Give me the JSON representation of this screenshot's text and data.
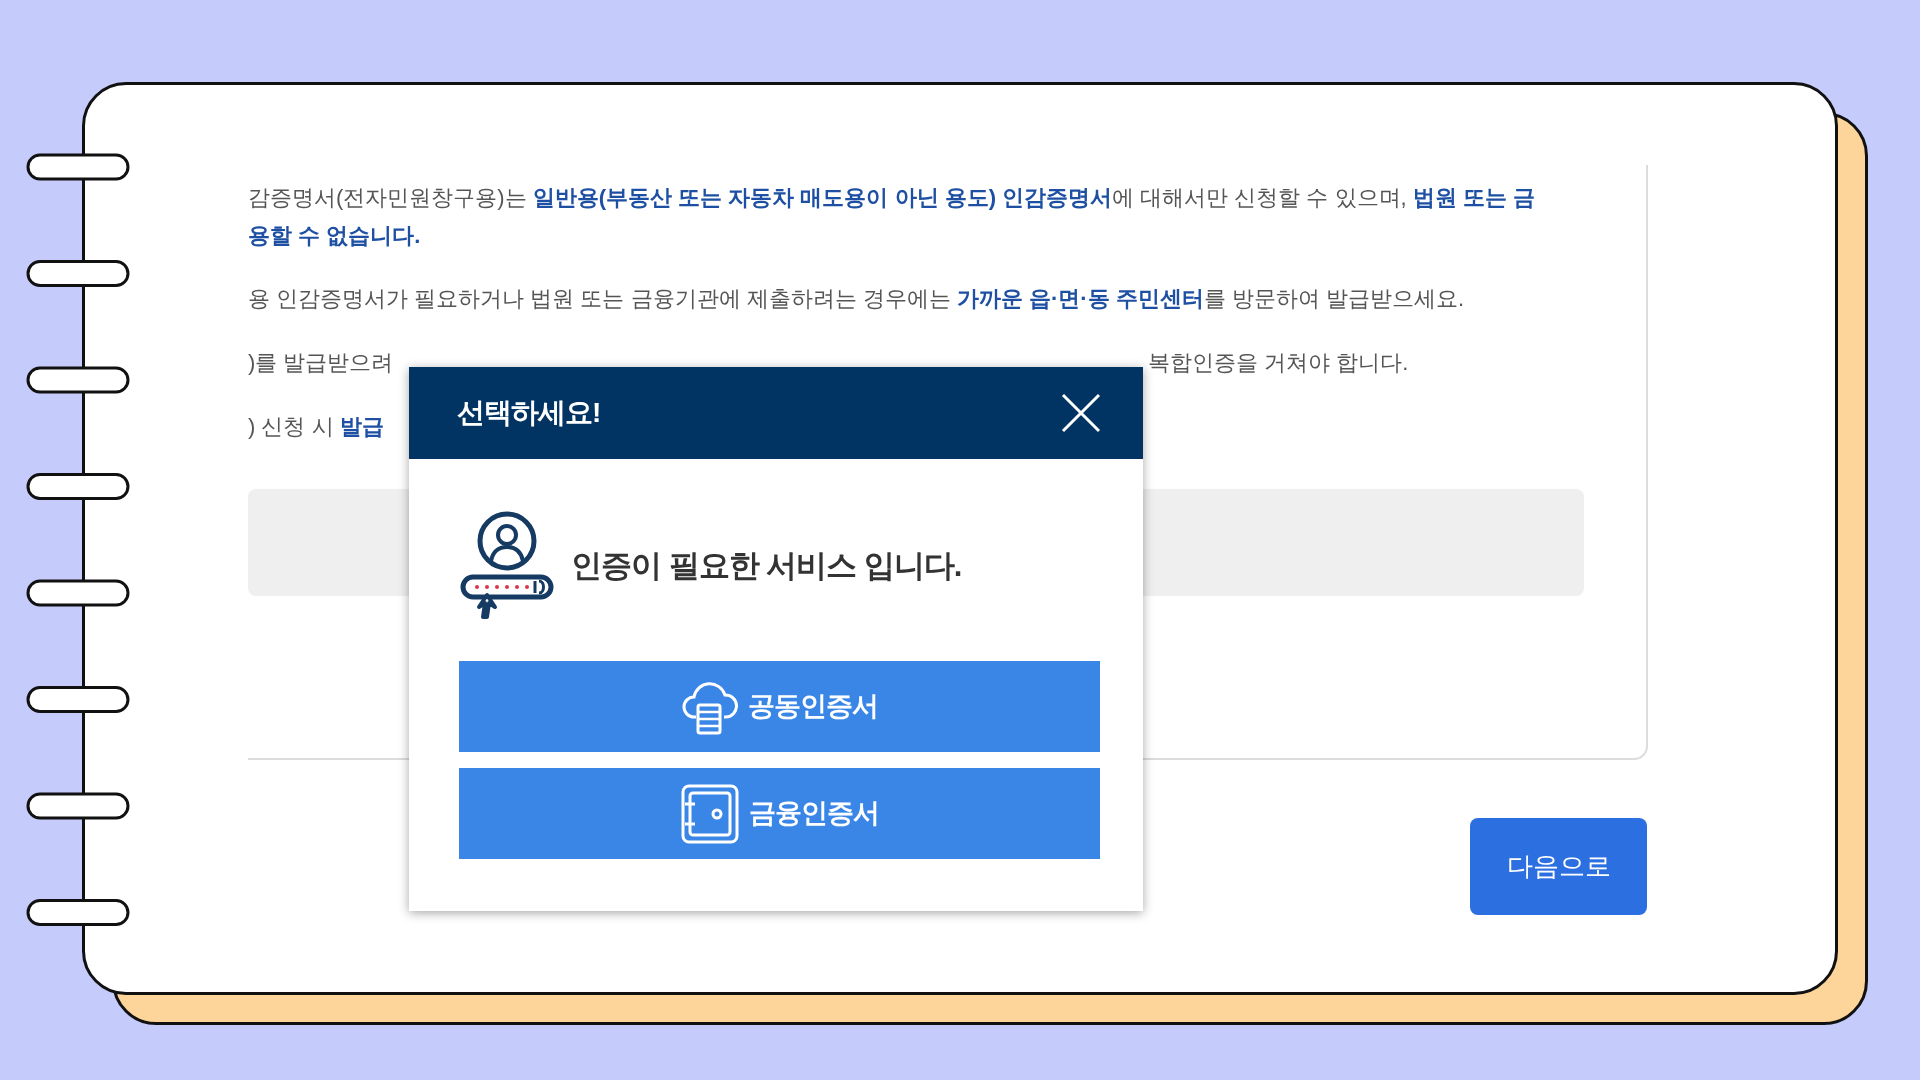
{
  "notice": {
    "lines": [
      {
        "segments": [
          "감증명서(전자민원창구용)는 **일반용(부동산 또는 자동차 매도용이 아닌 용도) 인감증명서**에 대해서만 신청할 수 있으며, **법원 또는 금**"
        ]
      },
      {
        "segments": [
          "**용할 수 없습니다.**"
        ]
      },
      {
        "segments": [
          "용 인감증명서가 필요하거나 법원 또는 금융기관에 제출하려는 경우에는 **가까운 읍·면·동 주민센터**를 방문하여 발급받으세요."
        ]
      },
      {
        "segments": [
          ")를 발급받으려",
          "복합인증을 거쳐야 합니다."
        ]
      },
      {
        "segments": [
          ") 신청 시 **발급**"
        ]
      }
    ]
  },
  "next_button": {
    "label": "다음으로"
  },
  "modal": {
    "title": "선택하세요!",
    "message": "인증이 필요한 서비스 입니다.",
    "options": [
      {
        "kind": "cloud",
        "label": "공동인증서"
      },
      {
        "kind": "safe",
        "label": "금융인증서"
      }
    ]
  }
}
